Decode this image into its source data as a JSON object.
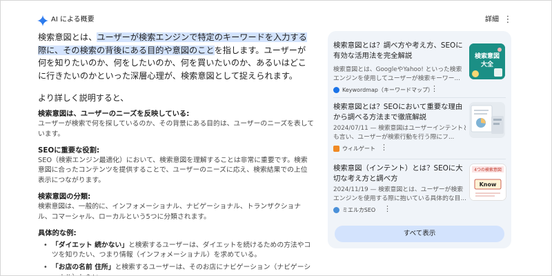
{
  "header": {
    "title": "AI による概要",
    "detail_label": "詳細",
    "more_icon": "more-vert-icon"
  },
  "overview": {
    "intro_part1": "検索意図とは、",
    "intro_highlight": "ユーザーが検索エンジンで特定のキーワードを入力する際に、その検索の背後にある目的や意図のこと",
    "intro_part2": "を指します。ユーザーが何を知りたいのか、何をしたいのか、何を買いたいのか、あるいはどこに行きたいのかといった深層心理が、検索意図として捉えられます。",
    "more_detail": "より詳しく説明すると、",
    "sections": [
      {
        "heading": "検索意図は、ユーザーのニーズを反映している:",
        "body": "ユーザーが検索で何を探しているのか、その背景にある目的は、ユーザーのニーズを表しています。"
      },
      {
        "heading": "SEOに重要な役割:",
        "body": "SEO（検索エンジン最適化）において、検索意図を理解することは非常に重要です。検索意図に合ったコンテンツを提供することで、ユーザーのニーズに応え、検索結果での上位表示につながります。"
      },
      {
        "heading": "検索意図の分類:",
        "body": "検索意図は、一般的に、インフォメーショナル、ナビゲーショナル、トランザクショナル、コマーシャル、ローカルという5つに分類されます。"
      }
    ],
    "examples_heading": "具体的な例:",
    "examples": [
      {
        "keyword": "「ダイエット 続かない」",
        "text": "と検索するユーザーは、ダイエットを続けるための方法やコツを知りたい、つまり情報（インフォメーショナル）を求めている。"
      },
      {
        "keyword": "「お店の名前 住所」",
        "text": "と検索するユーザーは、そのお店にナビゲーション（ナビゲーショナル）したい。"
      }
    ]
  },
  "sources": {
    "cards": [
      {
        "title": "検索意図とは？調べ方や考え方、SEOに有効な活用法を完全解説",
        "snippet_line1": "検索意図とは、GoogleやYahoo! といった検索",
        "snippet_line2": "エンジンを使用してユーザーが検索キーワー...",
        "source": "Keywordmap（キーワードマップ）",
        "thumb_text_line1": "検索意図",
        "thumb_text_line2": "大全",
        "icon_color": "#1a73e8"
      },
      {
        "title": "検索意図とは？SEOにおいて重要な理由から調べる方法まで徹底解説",
        "snippet_line1": "2024/07/11 — 検索意図はユーザーインテントと",
        "snippet_line2": "も言い、ユーザーが検索行動を行う際にフ...",
        "source": "ウィルゲート",
        "icon_color": "#f08a24"
      },
      {
        "title": "検索意図（インテント）とは？SEOに大切な考え方と調べ方",
        "snippet_line1": "2024/11/19 — 検索意図とは、ユーザーが検索",
        "snippet_line2": "エンジンを使用する際に抱いている具体的な目...",
        "source": "ミエルカSEO",
        "thumb_text_line1": "4つの検索意図",
        "thumb_text_line2": "Know",
        "icon_color": "#4a90d9"
      }
    ],
    "show_all_label": "すべて表示"
  },
  "colors": {
    "highlight": "#d3e3fd",
    "panel_bg": "#f0f4f9",
    "accent_blue": "#1a73e8"
  }
}
